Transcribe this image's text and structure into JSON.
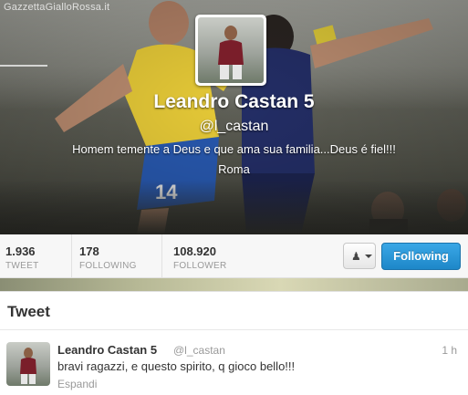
{
  "header": {
    "watermark": "GazzettaGialloRossa.it",
    "name": "Leandro Castan 5",
    "handle": "@l_castan",
    "bio": "Homem temente a Deus e que ama sua familia...Deus é fiel!!!",
    "location": "Roma"
  },
  "stats": [
    {
      "value": "1.936",
      "label": "TWEET"
    },
    {
      "value": "178",
      "label": "FOLLOWING"
    },
    {
      "value": "108.920",
      "label": "FOLLOWER"
    }
  ],
  "actions": {
    "user_menu_icon": "person-dropdown-icon",
    "follow_label": "Following"
  },
  "tweets": {
    "title": "Tweet",
    "items": [
      {
        "name": "Leandro Castan 5",
        "handle": "@l_castan",
        "time": "1 h",
        "text": "bravi ragazzi, e questo spirito, q gioco bello!!!",
        "expand_label": "Espandi"
      }
    ]
  },
  "colors": {
    "accent": "#2a95d8",
    "text": "#333333",
    "muted": "#999999"
  }
}
